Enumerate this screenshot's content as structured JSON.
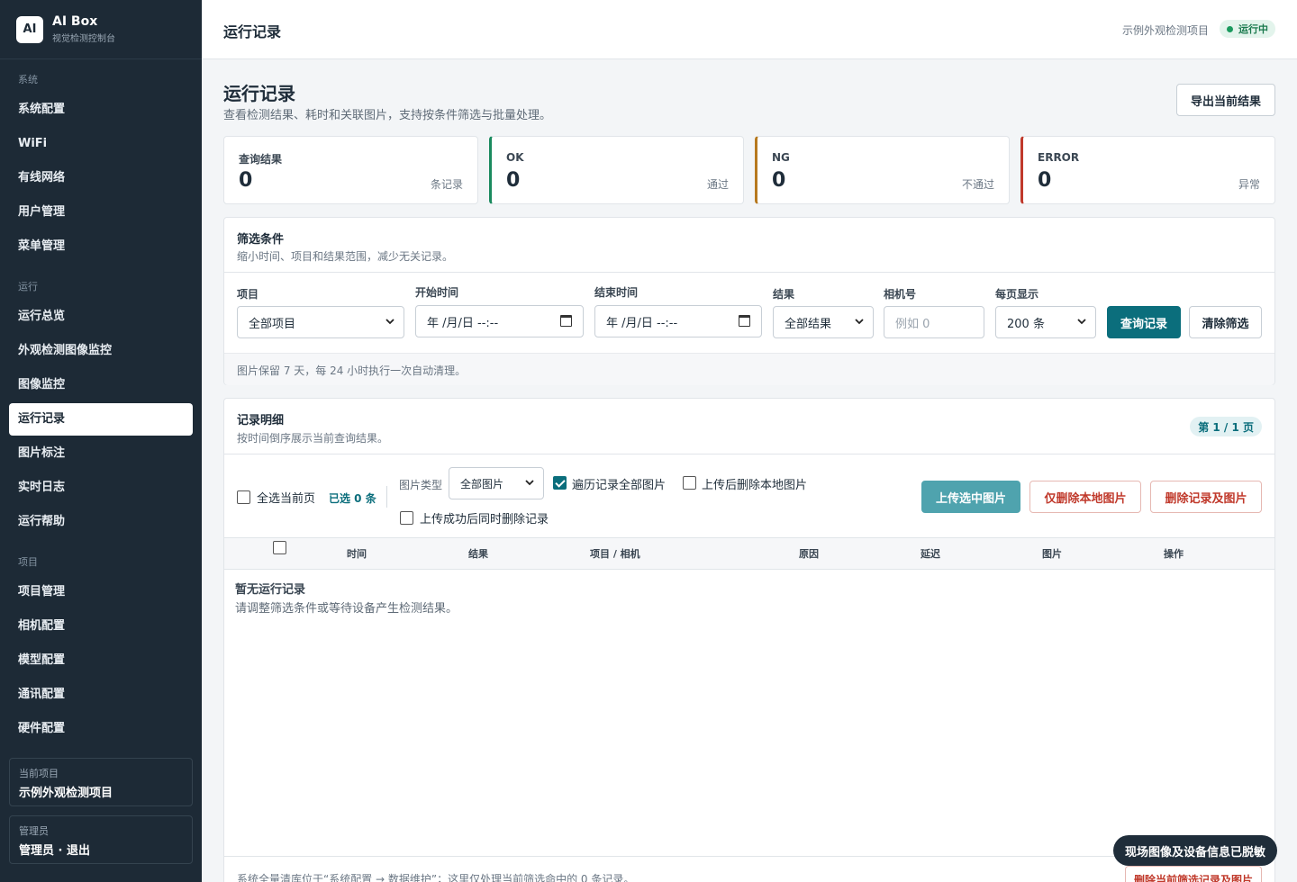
{
  "brand": {
    "logo": "AI",
    "name": "AI Box",
    "subtitle": "视觉检测控制台"
  },
  "sidebar": {
    "sections": [
      {
        "label": "系统",
        "items": [
          "系统配置",
          "WiFi",
          "有线网络",
          "用户管理",
          "菜单管理"
        ]
      },
      {
        "label": "运行",
        "items": [
          "运行总览",
          "外观检测图像监控",
          "图像监控",
          "运行记录",
          "图片标注",
          "实时日志",
          "运行帮助"
        ]
      },
      {
        "label": "项目",
        "items": [
          "项目管理",
          "相机配置",
          "模型配置",
          "通讯配置",
          "硬件配置"
        ]
      }
    ],
    "active_item": "运行记录",
    "current_project": {
      "title": "当前项目",
      "value": "示例外观检测项目"
    },
    "admin": {
      "title": "管理员",
      "value": "管理员 · 退出"
    }
  },
  "topbar": {
    "title": "运行记录",
    "project": "示例外观检测项目",
    "status": "运行中",
    "status_color": "#1a9a5e"
  },
  "page": {
    "title": "运行记录",
    "description": "查看检测结果、耗时和关联图片，支持按条件筛选与批量处理。",
    "export_button": "导出当前结果"
  },
  "stats": [
    {
      "label": "查询结果",
      "value": "0",
      "unit": "条记录",
      "color": "#e1e5e9"
    },
    {
      "label": "OK",
      "value": "0",
      "unit": "通过",
      "color": "#1a8a5e"
    },
    {
      "label": "NG",
      "value": "0",
      "unit": "不通过",
      "color": "#b7791f"
    },
    {
      "label": "ERROR",
      "value": "0",
      "unit": "异常",
      "color": "#c0392b"
    }
  ],
  "filters": {
    "title": "筛选条件",
    "subtitle": "缩小时间、项目和结果范围，减少无关记录。",
    "project": {
      "label": "项目",
      "value": "全部项目"
    },
    "start_time": {
      "label": "开始时间",
      "value": "年 /月/日  --:--"
    },
    "end_time": {
      "label": "结束时间",
      "value": "年 /月/日  --:--"
    },
    "result": {
      "label": "结果",
      "value": "全部结果"
    },
    "camera": {
      "label": "相机号",
      "placeholder": "例如 0"
    },
    "page_size": {
      "label": "每页显示",
      "value": "200 条"
    },
    "query_button": "查询记录",
    "clear_button": "清除筛选",
    "note": "图片保留 7 天，每 24 小时执行一次自动清理。"
  },
  "records": {
    "title": "记录明细",
    "subtitle": "按时间倒序展示当前查询结果。",
    "page_badge": "第 1 / 1 页",
    "select_page": "全选当前页",
    "selected_count": "已选 0 条",
    "image_type_label": "图片类型",
    "image_type_value": "全部图片",
    "traverse_all": "遍历记录全部图片",
    "traverse_all_checked": true,
    "delete_local_after_upload": "上传后删除本地图片",
    "delete_record_after_upload": "上传成功后同时删除记录",
    "upload_button": "上传选中图片",
    "delete_local_button": "仅删除本地图片",
    "delete_all_button": "删除记录及图片",
    "columns": [
      "时间",
      "结果",
      "项目 / 相机",
      "原因",
      "延迟",
      "图片",
      "操作"
    ],
    "empty_title": "暂无运行记录",
    "empty_desc": "请调整筛选条件或等待设备产生检测结果。",
    "footer_note": "系统全量清库位于“系统配置 → 数据维护”；这里仅处理当前筛选命中的 0 条记录。",
    "footer_button": "删除当前筛选记录及图片"
  },
  "toast": "现场图像及设备信息已脱敏"
}
